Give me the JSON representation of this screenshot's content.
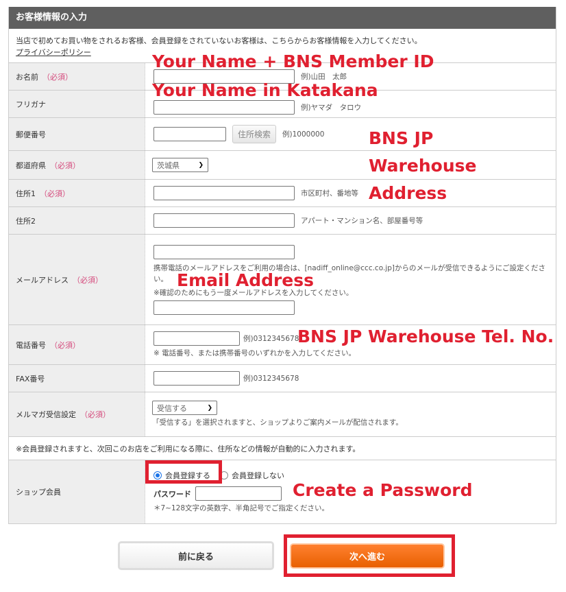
{
  "header": {
    "title": "お客様情報の入力"
  },
  "intro": {
    "text": "当店で初めてお買い物をされるお客様、会員登録をされていないお客様は、こちらからお客様情報を入力してください。",
    "privacy_link": "プライバシーポリシー"
  },
  "required_mark": "（必須）",
  "rows": {
    "name": {
      "label": "お名前",
      "hint": "例)山田　太郎",
      "value": ""
    },
    "furigana": {
      "label": "フリガナ",
      "hint": "例)ヤマダ　タロウ",
      "value": ""
    },
    "postal": {
      "label": "郵便番号",
      "button": "住所検索",
      "hint": "例)1000000",
      "value": ""
    },
    "prefecture": {
      "label": "都道府県",
      "selected": "茨城県"
    },
    "address1": {
      "label": "住所1",
      "hint": "市区町村、番地等",
      "value": ""
    },
    "address2": {
      "label": "住所2",
      "hint": "アパート・マンション名、部屋番号等",
      "value": ""
    },
    "email": {
      "label": "メールアドレス",
      "note1": "携帯電話のメールアドレスをご利用の場合は、[nadiff_online@ccc.co.jp]からのメールが受信できるようにご設定ください。",
      "note2": "※確認のためにもう一度メールアドレスを入力してください。",
      "value": "",
      "confirm_value": ""
    },
    "phone": {
      "label": "電話番号",
      "hint": "例)0312345678",
      "note": "※ 電話番号、または携帯番号のいずれかを入力してください。",
      "value": ""
    },
    "fax": {
      "label": "FAX番号",
      "hint": "例)0312345678",
      "value": ""
    },
    "newsletter": {
      "label": "メルマガ受信設定",
      "selected": "受信する",
      "note": "「受信する」を選択されますと、ショップよりご案内メールが配信されます。"
    },
    "member_notice": "※会員登録されますと、次回このお店をご利用になる際に、住所などの情報が自動的に入力されます。",
    "membership": {
      "label": "ショップ会員",
      "option_register": "会員登録する",
      "option_no_register": "会員登録しない",
      "selected": "会員登録する",
      "password_label": "パスワード",
      "password_note": "＊7~128文字の英数字、半角記号でご指定ください。"
    }
  },
  "buttons": {
    "back": "前に戻る",
    "next": "次へ進む"
  },
  "annotations": {
    "name": "Your Name + BNS Member ID",
    "katakana": "Your Name in Katakana",
    "warehouse1": "BNS JP",
    "warehouse2": "Warehouse",
    "warehouse3": "Address",
    "email": "Email Address",
    "phone": "BNS JP Warehouse Tel. No.",
    "password": "Create a Password"
  },
  "colors": {
    "header_bg": "#5f5f5f",
    "required": "#d4477a",
    "annotation": "#e02030",
    "next_button": "#f06a10"
  }
}
